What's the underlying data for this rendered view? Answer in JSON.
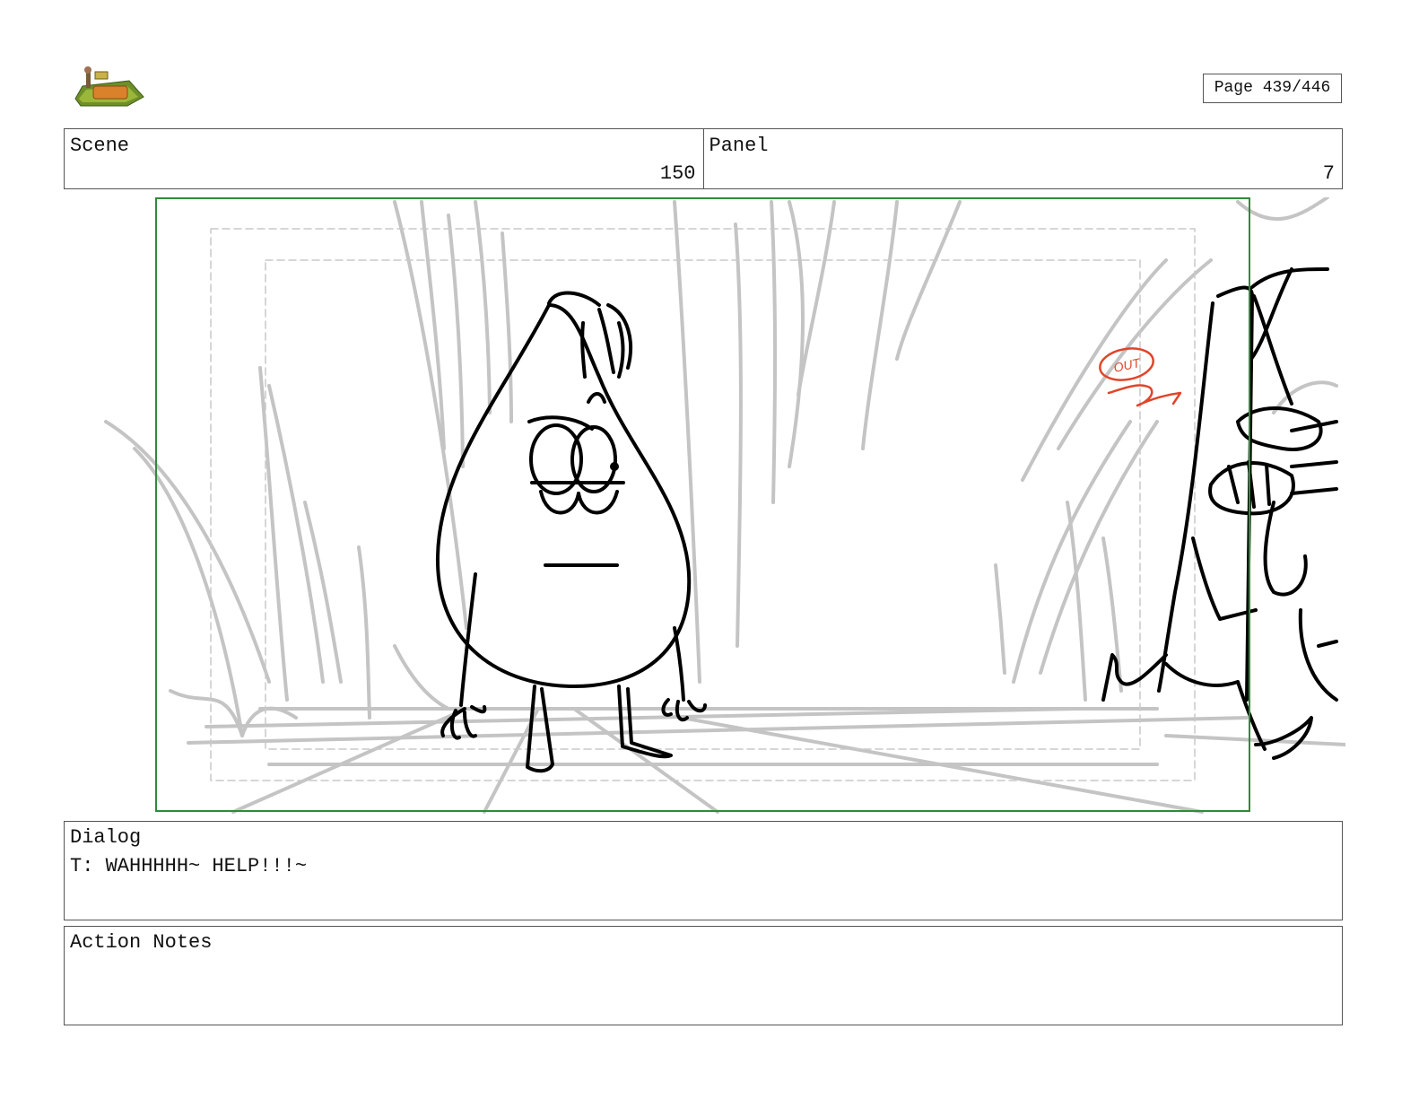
{
  "header": {
    "page_label": "Page 439/446"
  },
  "scene": {
    "label": "Scene",
    "value": "150"
  },
  "panel": {
    "label": "Panel",
    "value": "7"
  },
  "artwork": {
    "annotation": "OUT"
  },
  "dialog": {
    "label": "Dialog",
    "text": "T: WAHHHHH~ HELP!!!~"
  },
  "action_notes": {
    "label": "Action Notes",
    "text": ""
  },
  "colors": {
    "frame_border": "#2e8b3a",
    "sketch_grey": "#c4c4c4",
    "ink": "#000000",
    "annotation_red": "#e0452a"
  }
}
